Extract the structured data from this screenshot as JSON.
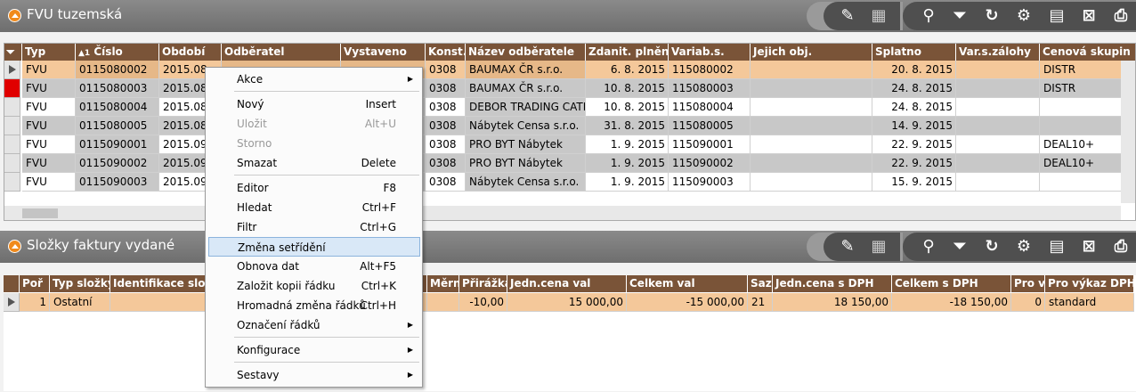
{
  "top": {
    "title": "FVU tuzemská",
    "columns": [
      "Typ",
      "Číslo",
      "Období",
      "Odběratel",
      "Vystaveno",
      "Konst.",
      "Název odběratele",
      "Zdanit. plnění",
      "Variab.s.",
      "Jejich obj.",
      "Splatno",
      "Var.s.zálohy",
      "Cenová skupin"
    ],
    "sort_mark": "▲1",
    "rows": [
      [
        "FVU",
        "0115080002",
        "2015.08",
        "",
        "",
        "0308",
        "BAUMAX ČR s.r.o.",
        "6. 8. 2015",
        "115080002",
        "",
        "20. 8. 2015",
        "",
        "DISTR"
      ],
      [
        "FVU",
        "0115080003",
        "2015.08",
        "",
        "",
        "0308",
        "BAUMAX ČR s.r.o.",
        "10. 8. 2015",
        "115080003",
        "",
        "24. 8. 2015",
        "",
        "DISTR"
      ],
      [
        "FVU",
        "0115080004",
        "2015.08",
        "",
        "",
        "0308",
        "DEBOR TRADING CATE",
        "10. 8. 2015",
        "115080004",
        "",
        "24. 8. 2015",
        "",
        ""
      ],
      [
        "FVU",
        "0115080005",
        "2015.08",
        "",
        "",
        "0308",
        "Nábytek Censa s.r.o.",
        "31. 8. 2015",
        "115080005",
        "",
        "14. 9. 2015",
        "",
        ""
      ],
      [
        "FVU",
        "0115090001",
        "2015.09",
        "",
        "",
        "0308",
        "PRO BYT Nábytek",
        "1. 9. 2015",
        "115090001",
        "",
        "22. 9. 2015",
        "",
        "DEAL10+"
      ],
      [
        "FVU",
        "0115090002",
        "2015.09",
        "",
        "",
        "0308",
        "PRO BYT Nábytek",
        "1. 9. 2015",
        "115090002",
        "",
        "22. 9. 2015",
        "",
        "DEAL10+"
      ],
      [
        "FVU",
        "0115090003",
        "2015.09",
        "",
        "",
        "0308",
        "Nábytek Censa s.r.o.",
        "1. 9. 2015",
        "115090003",
        "",
        "15. 9. 2015",
        "",
        ""
      ]
    ]
  },
  "bottom": {
    "title": "Složky faktury vydané",
    "columns": [
      "Poř",
      "Typ složky",
      "Identifikace slož",
      "",
      "Měrn",
      "Přirážka",
      "Jedn.cena val",
      "Celkem val",
      "Saz",
      "Jedn.cena s DPH",
      "Celkem s DPH",
      "Pro v",
      "Pro výkaz DPH -"
    ],
    "rows": [
      [
        "1",
        "Ostatní",
        "",
        "",
        "",
        "-10,00",
        "15 000,00",
        "-15 000,00",
        "21",
        "18 150,00",
        "-18 150,00",
        "0",
        "standard"
      ]
    ]
  },
  "menu": [
    {
      "label": "Akce",
      "shortcut": "",
      "arrow": true
    },
    {
      "label": "Nový",
      "shortcut": "Insert"
    },
    {
      "label": "Uložit",
      "shortcut": "Alt+U",
      "disabled": true
    },
    {
      "label": "Storno",
      "shortcut": "",
      "disabled": true
    },
    {
      "label": "Smazat",
      "shortcut": "Delete"
    },
    {
      "label": "Editor",
      "shortcut": "F8"
    },
    {
      "label": "Hledat",
      "shortcut": "Ctrl+F"
    },
    {
      "label": "Filtr",
      "shortcut": "Ctrl+G"
    },
    {
      "label": "Změna setřídění",
      "shortcut": "",
      "highlighted": true
    },
    {
      "label": "Obnova dat",
      "shortcut": "Alt+F5"
    },
    {
      "label": "Založit kopii řádku",
      "shortcut": "Ctrl+K"
    },
    {
      "label": "Hromadná změna řádků",
      "shortcut": "Ctrl+H"
    },
    {
      "label": "Označení řádků",
      "shortcut": "",
      "arrow": true
    },
    {
      "label": "Konfigurace",
      "shortcut": "",
      "arrow": true
    },
    {
      "label": "Sestavy",
      "shortcut": "",
      "arrow": true
    }
  ],
  "icons": [
    "edit-icon",
    "grid-icon",
    "search-icon",
    "filter-icon",
    "refresh-icon",
    "user-settings-icon",
    "document-icon",
    "excel-icon",
    "print-icon"
  ],
  "colors": {
    "header": "#7a5438",
    "selected_row": "#f4c89a",
    "accent": "#f08a1c"
  }
}
